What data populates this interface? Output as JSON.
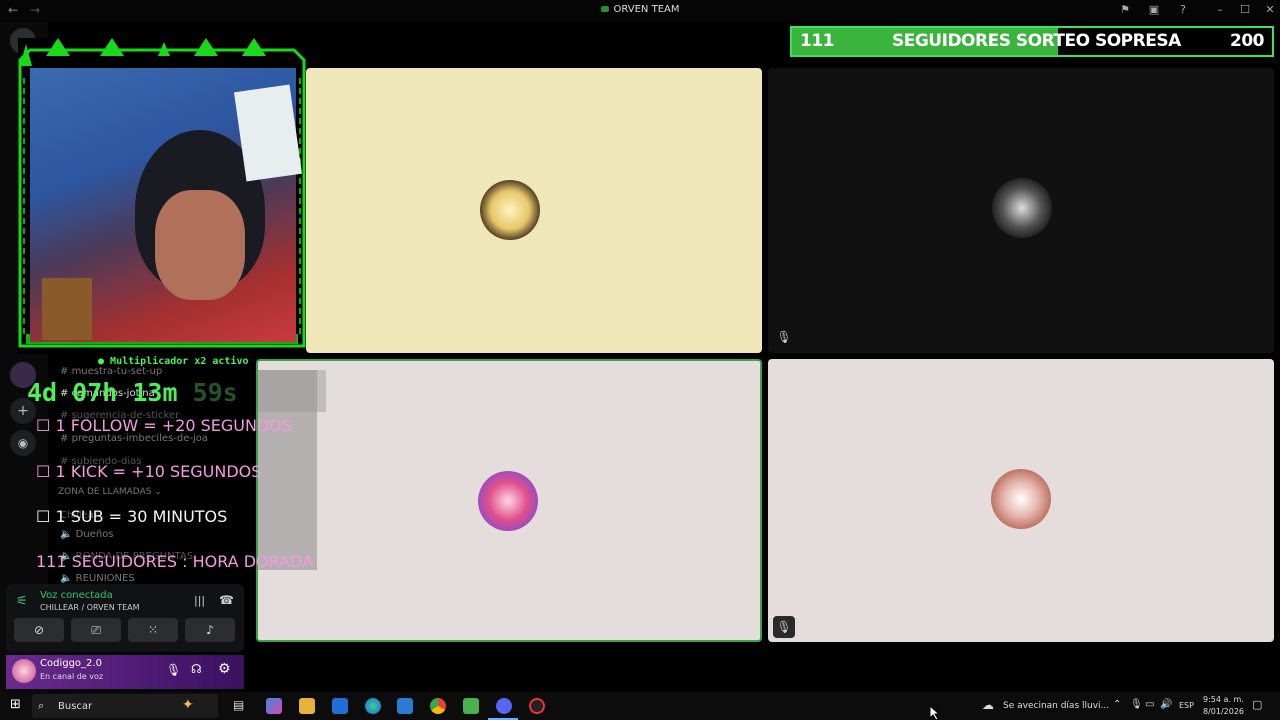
{
  "window": {
    "title": "ORVEN TEAM"
  },
  "progress_bar": {
    "current_label": "111",
    "goal_label": "SEGUIDORES SORTEO SOPRESA",
    "target_label": "200",
    "current": 111,
    "target": 200,
    "fill_fraction": 0.555,
    "fill_color": "#3ab43c",
    "border_color": "#3ee060"
  },
  "multiplier": {
    "text": "Multiplicador x2 activo"
  },
  "timer": {
    "main": "4d 07h 13m",
    "seconds": "59s"
  },
  "rules": [
    {
      "prefix": "☐",
      "text": "1 FOLLOW = +20 SEGUNDOS"
    },
    {
      "prefix": "☐",
      "text": "1 KICK  = +10 SEGUNDOS"
    },
    {
      "prefix": "☐",
      "text": "1 SUB = 30 MINUTOS"
    },
    {
      "prefix": "",
      "text": "111 SEGUIDORES : HORA DORADA"
    }
  ],
  "sidebar_channels": [
    "muestra-tu-set-up",
    "comandos-jotina",
    "sugerencia-de-sticker",
    "preguntas-imbeciles-de-joa",
    "subiendo-dias",
    "ZONA DE LLAMADAS",
    "Chillear",
    "Dueños",
    "RONDA DE PREGUNTAS",
    "REUNIONES"
  ],
  "voice": {
    "status": "Voz conectada",
    "channel": "CHILLEAR / ORVEN TEAM"
  },
  "user": {
    "name": "Codiggo_2.0",
    "status": "En canal de voz"
  },
  "tiles": [
    {
      "bg": "#efe7b8",
      "avatar": "blonde-character-avatar"
    },
    {
      "bg": "#111111",
      "avatar": "dark-haired-character-avatar"
    },
    {
      "bg": "#e5dcdc",
      "avatar": "pink-haired-character-avatar"
    },
    {
      "bg": "#e5dcdc",
      "avatar": "cat-ears-character-avatar"
    }
  ],
  "taskbar": {
    "search_label": "Buscar",
    "weather_text": "Se avecinan días lluvi...",
    "lang": "ESP",
    "time": "9:54 a. m.",
    "date": "8/01/2026"
  }
}
